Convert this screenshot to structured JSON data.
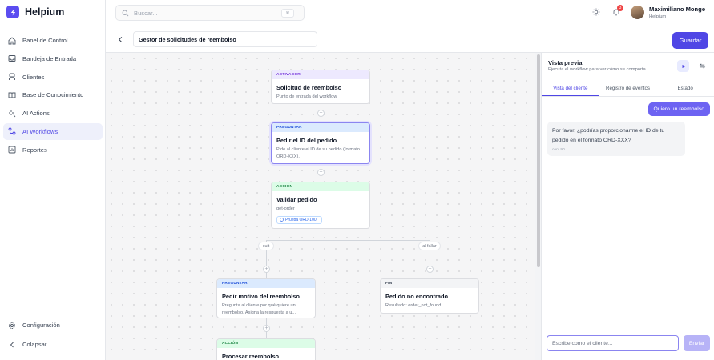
{
  "app": {
    "name": "Helpium"
  },
  "sidebar": {
    "items": [
      {
        "label": "Panel de Control",
        "icon": "home-icon",
        "active": false
      },
      {
        "label": "Bandeja de Entrada",
        "icon": "inbox-icon",
        "active": false
      },
      {
        "label": "Clientes",
        "icon": "users-icon",
        "active": false
      },
      {
        "label": "Base de Conocimiento",
        "icon": "book-icon",
        "active": false
      },
      {
        "label": "AI Actions",
        "icon": "sparkle-icon",
        "active": false
      },
      {
        "label": "AI Workflows",
        "icon": "workflow-icon",
        "active": true
      },
      {
        "label": "Reportes",
        "icon": "chart-icon",
        "active": false
      }
    ],
    "settings_label": "Configuración",
    "collapse_label": "Colapsar"
  },
  "header": {
    "search_placeholder": "Buscar...",
    "search_shortcut": "⌘",
    "notification_count": "3",
    "user": {
      "name": "Maximiliano Monge",
      "org": "Helpium"
    }
  },
  "workflow": {
    "title": "Gestor de solicitudes de reembolso",
    "save_label": "Guardar",
    "nodes": {
      "trigger": {
        "type": "ACTIVADOR",
        "title": "Solicitud de reembolso",
        "desc": "Punto de entrada del workflow"
      },
      "ask_order": {
        "type": "PREGUNTAR",
        "title": "Pedir el ID del pedido",
        "desc": "Pide al cliente el ID de su pedido (formato ORD-XXX)."
      },
      "validate": {
        "type": "ACCIÓN",
        "title": "Validar pedido",
        "desc": "get-order",
        "badge": "Prueba ORD-100"
      },
      "ask_reason": {
        "type": "PREGUNTAR",
        "title": "Pedir motivo del reembolso",
        "desc": "Pregunta al cliente por qué quiere un reembolso. Asigna la respuesta a u..."
      },
      "not_found": {
        "type": "FIN",
        "title": "Pedido no encontrado",
        "desc": "Resultado: order_not_found"
      },
      "process": {
        "type": "ACCIÓN",
        "title": "Procesar reembolso"
      }
    },
    "branches": {
      "true_label": "cuit",
      "false_label": "al fallar"
    }
  },
  "preview": {
    "title": "Vista previa",
    "subtitle": "Ejecuta el workflow para ver cómo se comporta.",
    "tabs": [
      "Vista del cliente",
      "Registro de eventos",
      "Estado"
    ],
    "active_tab": 0,
    "messages": {
      "user": "Quiero un reembolso",
      "bot": "Por favor, ¿podrías proporcionarme el ID de tu pedido en el formato ORD-XXX?",
      "bot_time": "cont 90"
    },
    "composer_placeholder": "Escribe como el cliente...",
    "send_label": "Enviar"
  },
  "colors": {
    "accent": "#4f46e5",
    "trigger_head": "#ede9fe",
    "ask_head": "#dbeafe",
    "action_head": "#dcfce7",
    "end_head": "#f3f4f6"
  }
}
